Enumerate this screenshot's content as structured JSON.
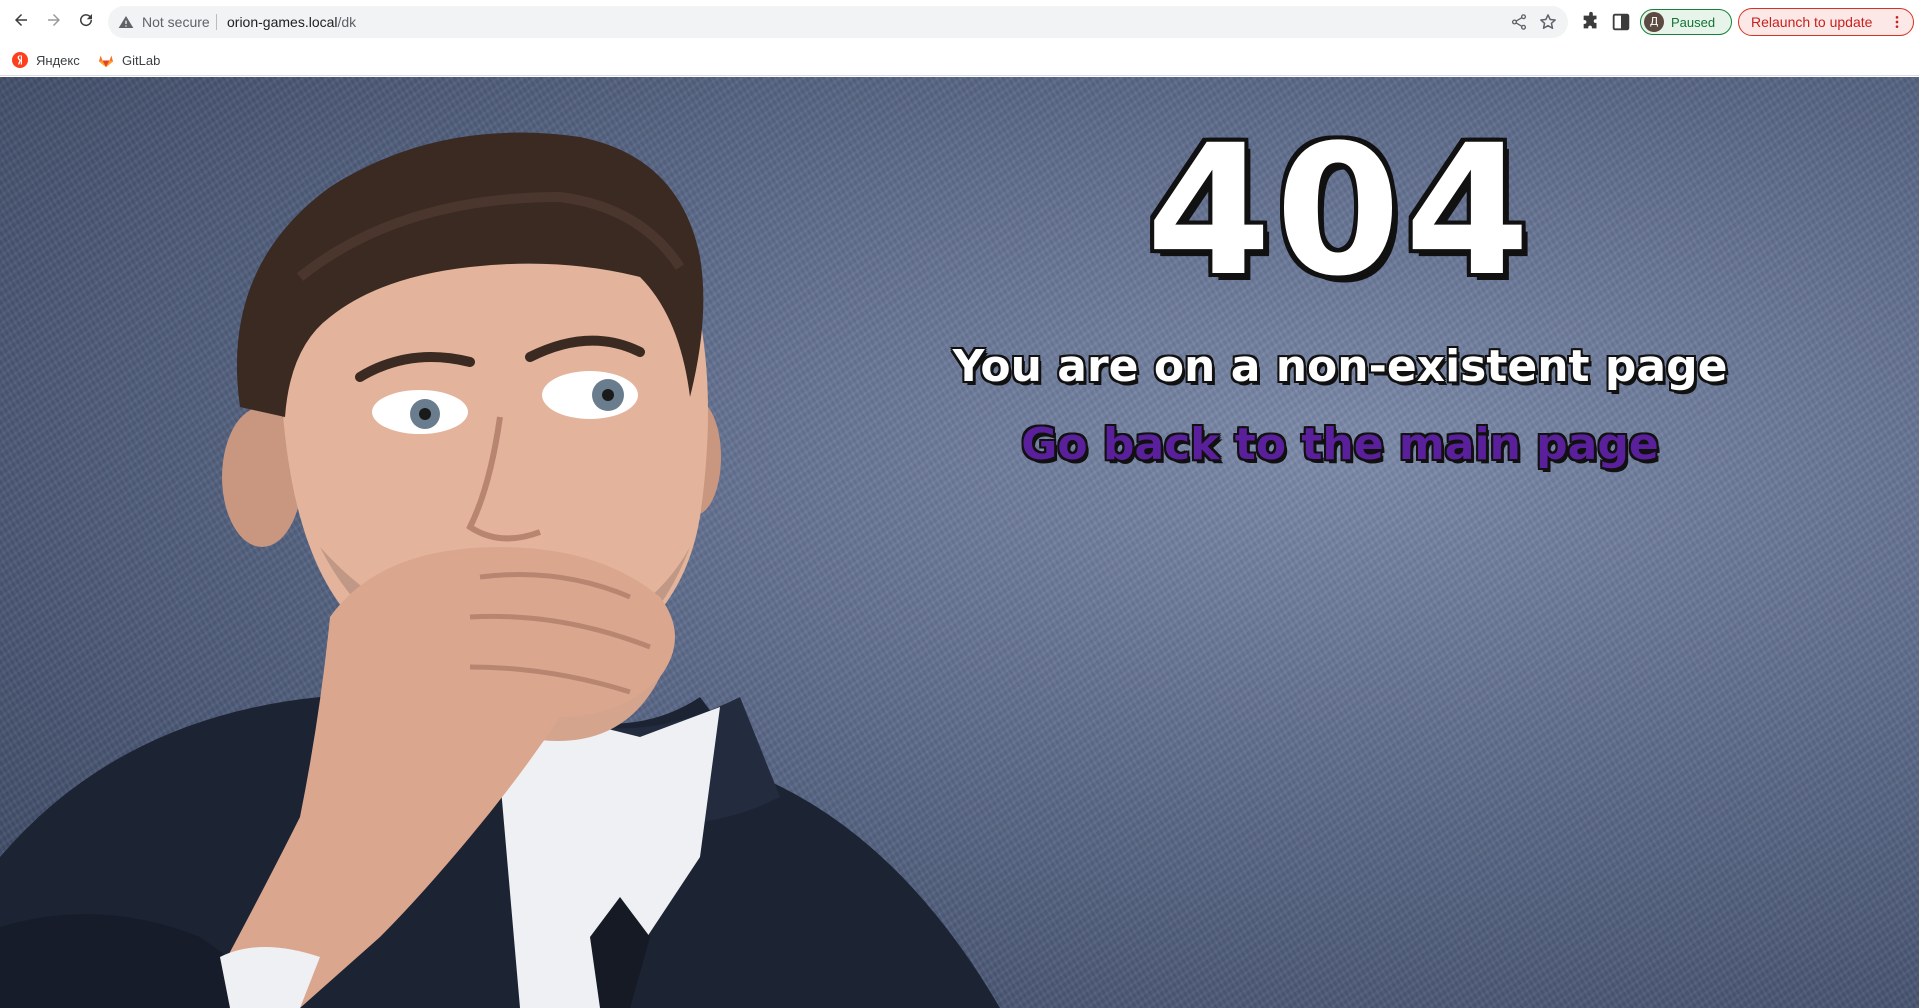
{
  "browser": {
    "omnibox": {
      "security_label": "Not secure",
      "url_host": "orion-games.local",
      "url_path": "/dk"
    },
    "profile": {
      "initial": "Д",
      "status": "Paused"
    },
    "relaunch_label": "Relaunch to update",
    "colors": {
      "profile_accent": "#188038",
      "relaunch_accent": "#d93025"
    }
  },
  "bookmarks": [
    {
      "label": "Яндекс",
      "icon": "yandex-icon"
    },
    {
      "label": "GitLab",
      "icon": "gitlab-icon"
    }
  ],
  "page": {
    "error_code": "404",
    "message": "You are on a non-existent page",
    "home_link": "Go back to the main page",
    "colors": {
      "link": "#5a1f9a",
      "background": "#5f6d8d"
    }
  }
}
